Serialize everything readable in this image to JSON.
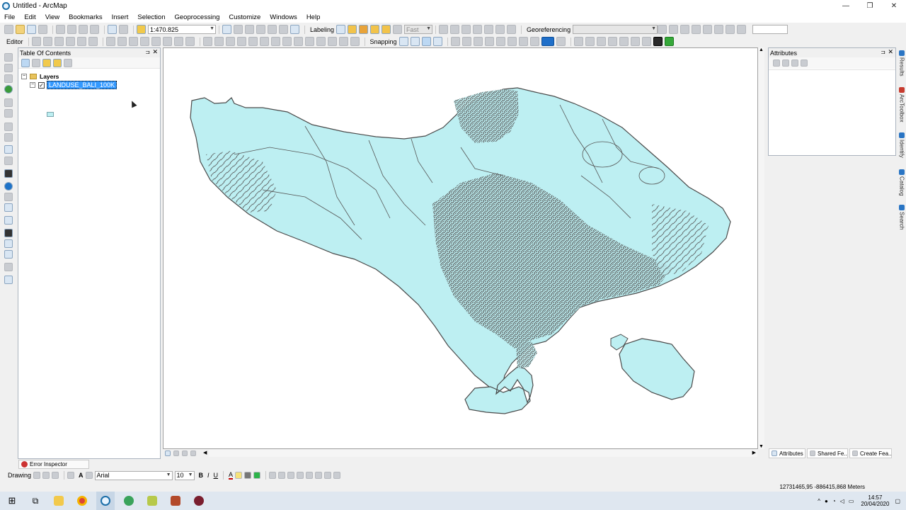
{
  "window": {
    "title": "Untitled - ArcMap"
  },
  "menu": [
    "File",
    "Edit",
    "View",
    "Bookmarks",
    "Insert",
    "Selection",
    "Geoprocessing",
    "Customize",
    "Windows",
    "Help"
  ],
  "toolbar": {
    "scale": "1:470.825",
    "labeling": "Labeling",
    "fast": "Fast",
    "georeferencing": "Georeferencing",
    "editor": "Editor",
    "snapping": "Snapping"
  },
  "toc": {
    "title": "Table Of Contents",
    "root": "Layers",
    "layer": "LANDUSE_BALI_100K"
  },
  "attributes": {
    "title": "Attributes"
  },
  "right_strip": [
    "Results",
    "ArcToolbox",
    "Identify",
    "Catalog",
    "Search"
  ],
  "bottom_tabs": [
    "Attributes",
    "Shared Fe...",
    "Create Fea..."
  ],
  "error_inspector": "Error Inspector",
  "drawing": {
    "label": "Drawing",
    "font": "Arial",
    "size": "10"
  },
  "status": {
    "coords": "12731465,95  -886415,868 Meters"
  },
  "taskbar": {
    "time": "14:57",
    "date": "20/04/2020"
  },
  "colors": {
    "land": "#bdeff2",
    "outline": "#4a4a4a",
    "selection": "#3399ff"
  }
}
